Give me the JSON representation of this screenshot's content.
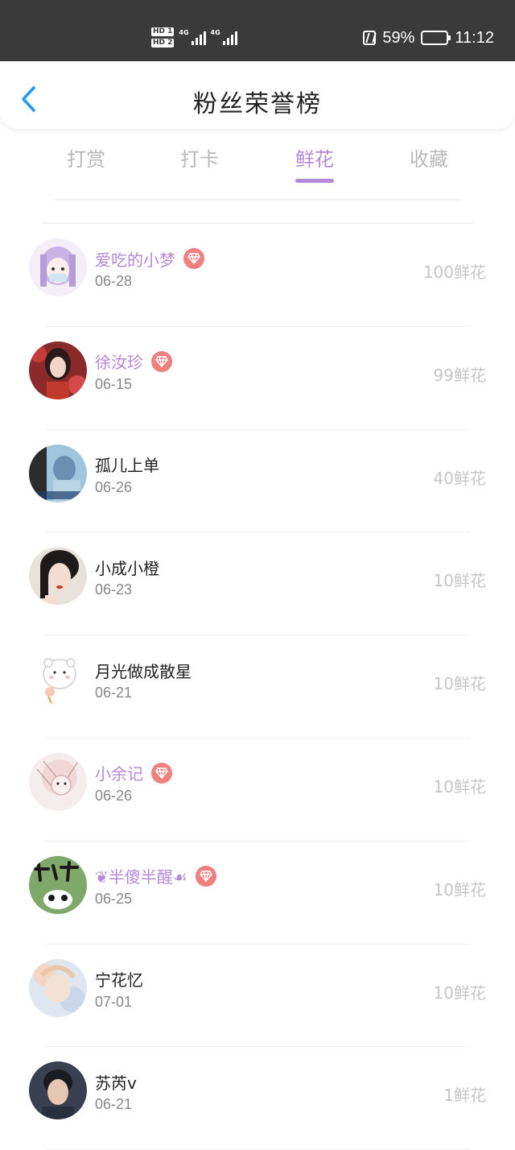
{
  "status_bar": {
    "hd1": "HD 1",
    "hd2": "HD 2",
    "net1": "4G",
    "net2": "4G",
    "battery_percent": "59%",
    "battery_level": 0.59,
    "time": "11:12"
  },
  "header": {
    "title": "粉丝荣誉榜",
    "back_icon": "chevron-left-icon"
  },
  "tabs": [
    {
      "label": "打赏",
      "active": false
    },
    {
      "label": "打卡",
      "active": false
    },
    {
      "label": "鲜花",
      "active": true
    },
    {
      "label": "收藏",
      "active": false
    }
  ],
  "colors": {
    "accent": "#b48ad8",
    "vip_badge": "#f08080",
    "status_bar": "#3a3a3a",
    "back_icon": "#2196f3"
  },
  "fans": [
    {
      "name": "爱吃的小梦",
      "vip": true,
      "date": "06-28",
      "amount": "100鲜花"
    },
    {
      "name": "徐汝珍",
      "vip": true,
      "date": "06-15",
      "amount": "99鲜花"
    },
    {
      "name": "孤儿上单",
      "vip": false,
      "date": "06-26",
      "amount": "40鲜花"
    },
    {
      "name": "小成小橙",
      "vip": false,
      "date": "06-23",
      "amount": "10鲜花"
    },
    {
      "name": "月光做成散星",
      "vip": false,
      "date": "06-21",
      "amount": "10鲜花"
    },
    {
      "name": "小余记",
      "vip": true,
      "date": "06-26",
      "amount": "10鲜花"
    },
    {
      "name": "❦半傻半醒☙",
      "vip": true,
      "date": "06-25",
      "amount": "10鲜花"
    },
    {
      "name": "宁花忆",
      "vip": false,
      "date": "07-01",
      "amount": "10鲜花"
    },
    {
      "name": "苏芮v",
      "vip": false,
      "date": "06-21",
      "amount": "1鲜花"
    }
  ]
}
